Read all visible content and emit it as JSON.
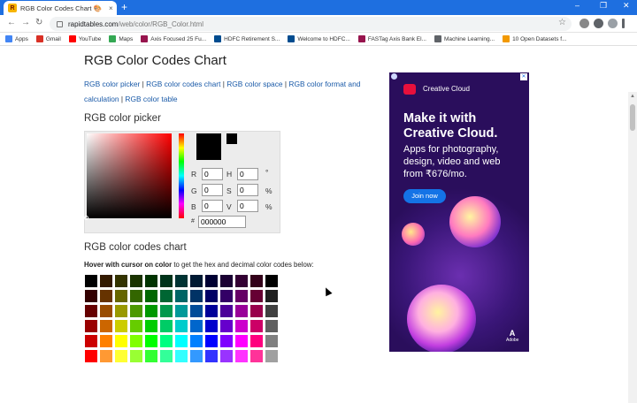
{
  "browser": {
    "tab_title": "RGB Color Codes Chart 🎨",
    "tab_close": "×",
    "new_tab": "+",
    "url_host": "rapidtables.com",
    "url_path": "/web/color/RGB_Color.html",
    "window_controls": [
      "–",
      "❐",
      "✕"
    ],
    "nav": {
      "back": "←",
      "forward": "→",
      "reload": "↻"
    },
    "star": "☆",
    "bookmarks": [
      {
        "label": "Apps",
        "color": "#4285f4"
      },
      {
        "label": "Gmail",
        "color": "#d93025"
      },
      {
        "label": "YouTube",
        "color": "#ff0000"
      },
      {
        "label": "Maps",
        "color": "#34a853"
      },
      {
        "label": "Axis Focused 25 Fu...",
        "color": "#97144d"
      },
      {
        "label": "HDFC Retirement S...",
        "color": "#004c8f"
      },
      {
        "label": "Welcome to HDFC...",
        "color": "#004c8f"
      },
      {
        "label": "FASTag Axis Bank El...",
        "color": "#97144d"
      },
      {
        "label": "Machine Learning...",
        "color": "#5f6368"
      },
      {
        "label": "10 Open Datasets f...",
        "color": "#f29900"
      }
    ]
  },
  "page": {
    "title": "RGB Color Codes Chart",
    "links": [
      "RGB color picker",
      "RGB color codes chart",
      "RGB color space",
      "RGB color format and calculation",
      "RGB color table"
    ],
    "link_sep": " | ",
    "picker_heading": "RGB color picker",
    "picker": {
      "labels": {
        "r": "R",
        "g": "G",
        "b": "B",
        "h": "H",
        "s": "S",
        "v": "V",
        "hash": "#"
      },
      "values": {
        "r": "0",
        "g": "0",
        "b": "0",
        "h": "0",
        "s": "0",
        "v": "0",
        "hex": "000000"
      },
      "units": {
        "h": "°",
        "s": "%",
        "v": "%"
      }
    },
    "chart_heading": "RGB color codes chart",
    "hover_bold": "Hover with cursor on color",
    "hover_rest": " to get the hex and decimal color codes below:",
    "color_grid": [
      [
        "#000000",
        "#331a00",
        "#333300",
        "#1a3300",
        "#003300",
        "#00331a",
        "#003333",
        "#001a33",
        "#000033",
        "#1a0033",
        "#330033",
        "#33001a",
        "#000000"
      ],
      [
        "#330000",
        "#663300",
        "#666600",
        "#336600",
        "#006600",
        "#006633",
        "#006666",
        "#003366",
        "#000066",
        "#330066",
        "#660066",
        "#660033",
        "#202020"
      ],
      [
        "#660000",
        "#994c00",
        "#999900",
        "#4c9900",
        "#009900",
        "#00994c",
        "#009999",
        "#004c99",
        "#000099",
        "#4c0099",
        "#990099",
        "#99004c",
        "#404040"
      ],
      [
        "#990000",
        "#cc6600",
        "#cccc00",
        "#66cc00",
        "#00cc00",
        "#00cc66",
        "#00cccc",
        "#0066cc",
        "#0000cc",
        "#6600cc",
        "#cc00cc",
        "#cc0066",
        "#606060"
      ],
      [
        "#cc0000",
        "#ff8000",
        "#ffff00",
        "#80ff00",
        "#00ff00",
        "#00ff80",
        "#00ffff",
        "#0080ff",
        "#0000ff",
        "#7f00ff",
        "#ff00ff",
        "#ff007f",
        "#808080"
      ],
      [
        "#ff0000",
        "#ff9933",
        "#ffff33",
        "#99ff33",
        "#33ff33",
        "#33ff99",
        "#33ffff",
        "#3399ff",
        "#3333ff",
        "#9933ff",
        "#ff33ff",
        "#ff3399",
        "#a0a0a0"
      ]
    ]
  },
  "ad": {
    "brand": "Creative Cloud",
    "headline": "Make it with Creative Cloud.",
    "sub": "Apps for photography, design, video and web from ₹676/mo.",
    "cta": "Join now",
    "adobe": "Adobe",
    "close": "✕"
  }
}
